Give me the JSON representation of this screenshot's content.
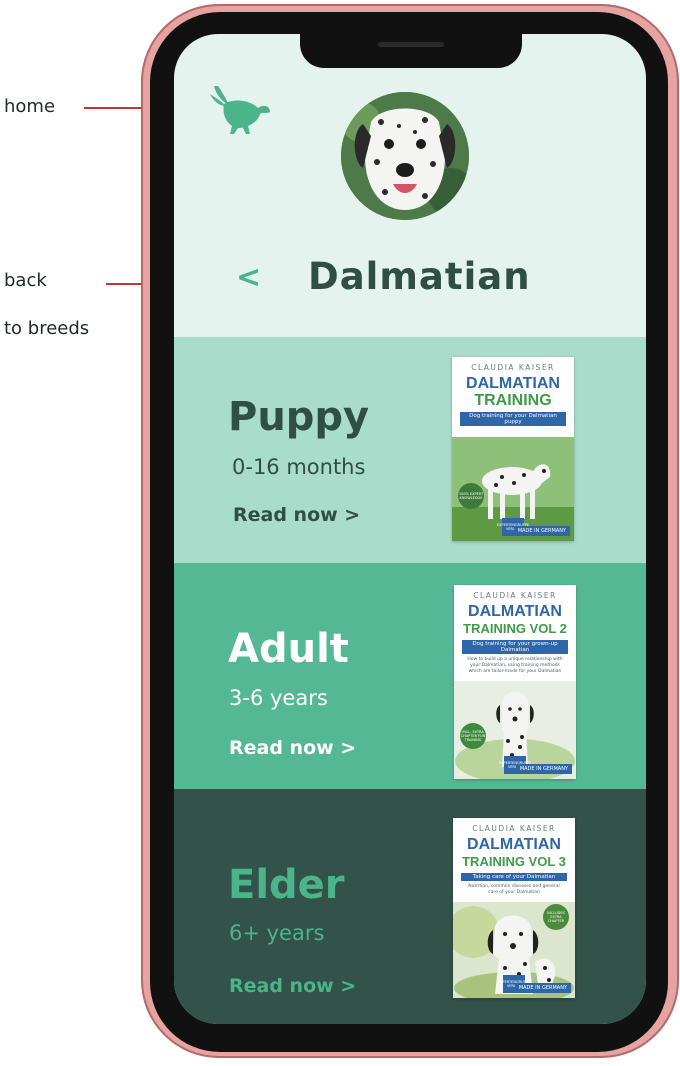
{
  "annotations": {
    "home": "home",
    "back_line1": "back",
    "back_line2": "to breeds",
    "line_color": "#c8303a"
  },
  "header": {
    "home_icon": "rabbit-icon",
    "back_label": "<",
    "breed_name": "Dalmatian"
  },
  "stages": [
    {
      "title": "Puppy",
      "age": "0-16 months",
      "cta": "Read now >",
      "bg": "#aadccb",
      "book": {
        "author": "CLAUDIA KAISER",
        "title_line1": "DALMATIAN",
        "title_line2": "TRAINING",
        "subtitle": "Dog training for your Dalmatian puppy",
        "badge": "100% EXPERT KNOWLEDGE",
        "made_in": "MADE IN GERMANY",
        "publisher": "EXPERTENGRUPPE VERLAG"
      }
    },
    {
      "title": "Adult",
      "age": "3-6 years",
      "cta": "Read now >",
      "bg": "#55b894",
      "book": {
        "author": "CLAUDIA KAISER",
        "title_line1": "DALMATIAN",
        "title_line2": "TRAINING VOL 2",
        "subtitle": "Dog training for your grown-up Dalmatian",
        "blurb": "How to build up a unique relationship with your Dalmatian, using training methods which are tailor-made for your Dalmatian",
        "badge": "INCL. EXTRA CHAPTER FUN TRAINING",
        "made_in": "MADE IN GERMANY",
        "publisher": "EXPERTENGRUPPE VERLAG"
      }
    },
    {
      "title": "Elder",
      "age": "6+ years",
      "cta": "Read now >",
      "bg": "#32524a",
      "book": {
        "author": "CLAUDIA KAISER",
        "title_line1": "DALMATIAN",
        "title_line2": "TRAINING VOL 3",
        "subtitle": "Taking care of your Dalmatian",
        "blurb": "Nutrition, common diseases and general care of your Dalmatian",
        "badge": "INCLUDES EXTRA CHAPTER",
        "made_in": "MADE IN GERMANY",
        "publisher": "EXPERTENGRUPPE VERLAG"
      }
    }
  ],
  "colors": {
    "screen_bg": "#e4f3ee",
    "accent": "#4bb48b",
    "title_dark": "#2f4f45",
    "phone_frame": "#e7a3a2"
  }
}
